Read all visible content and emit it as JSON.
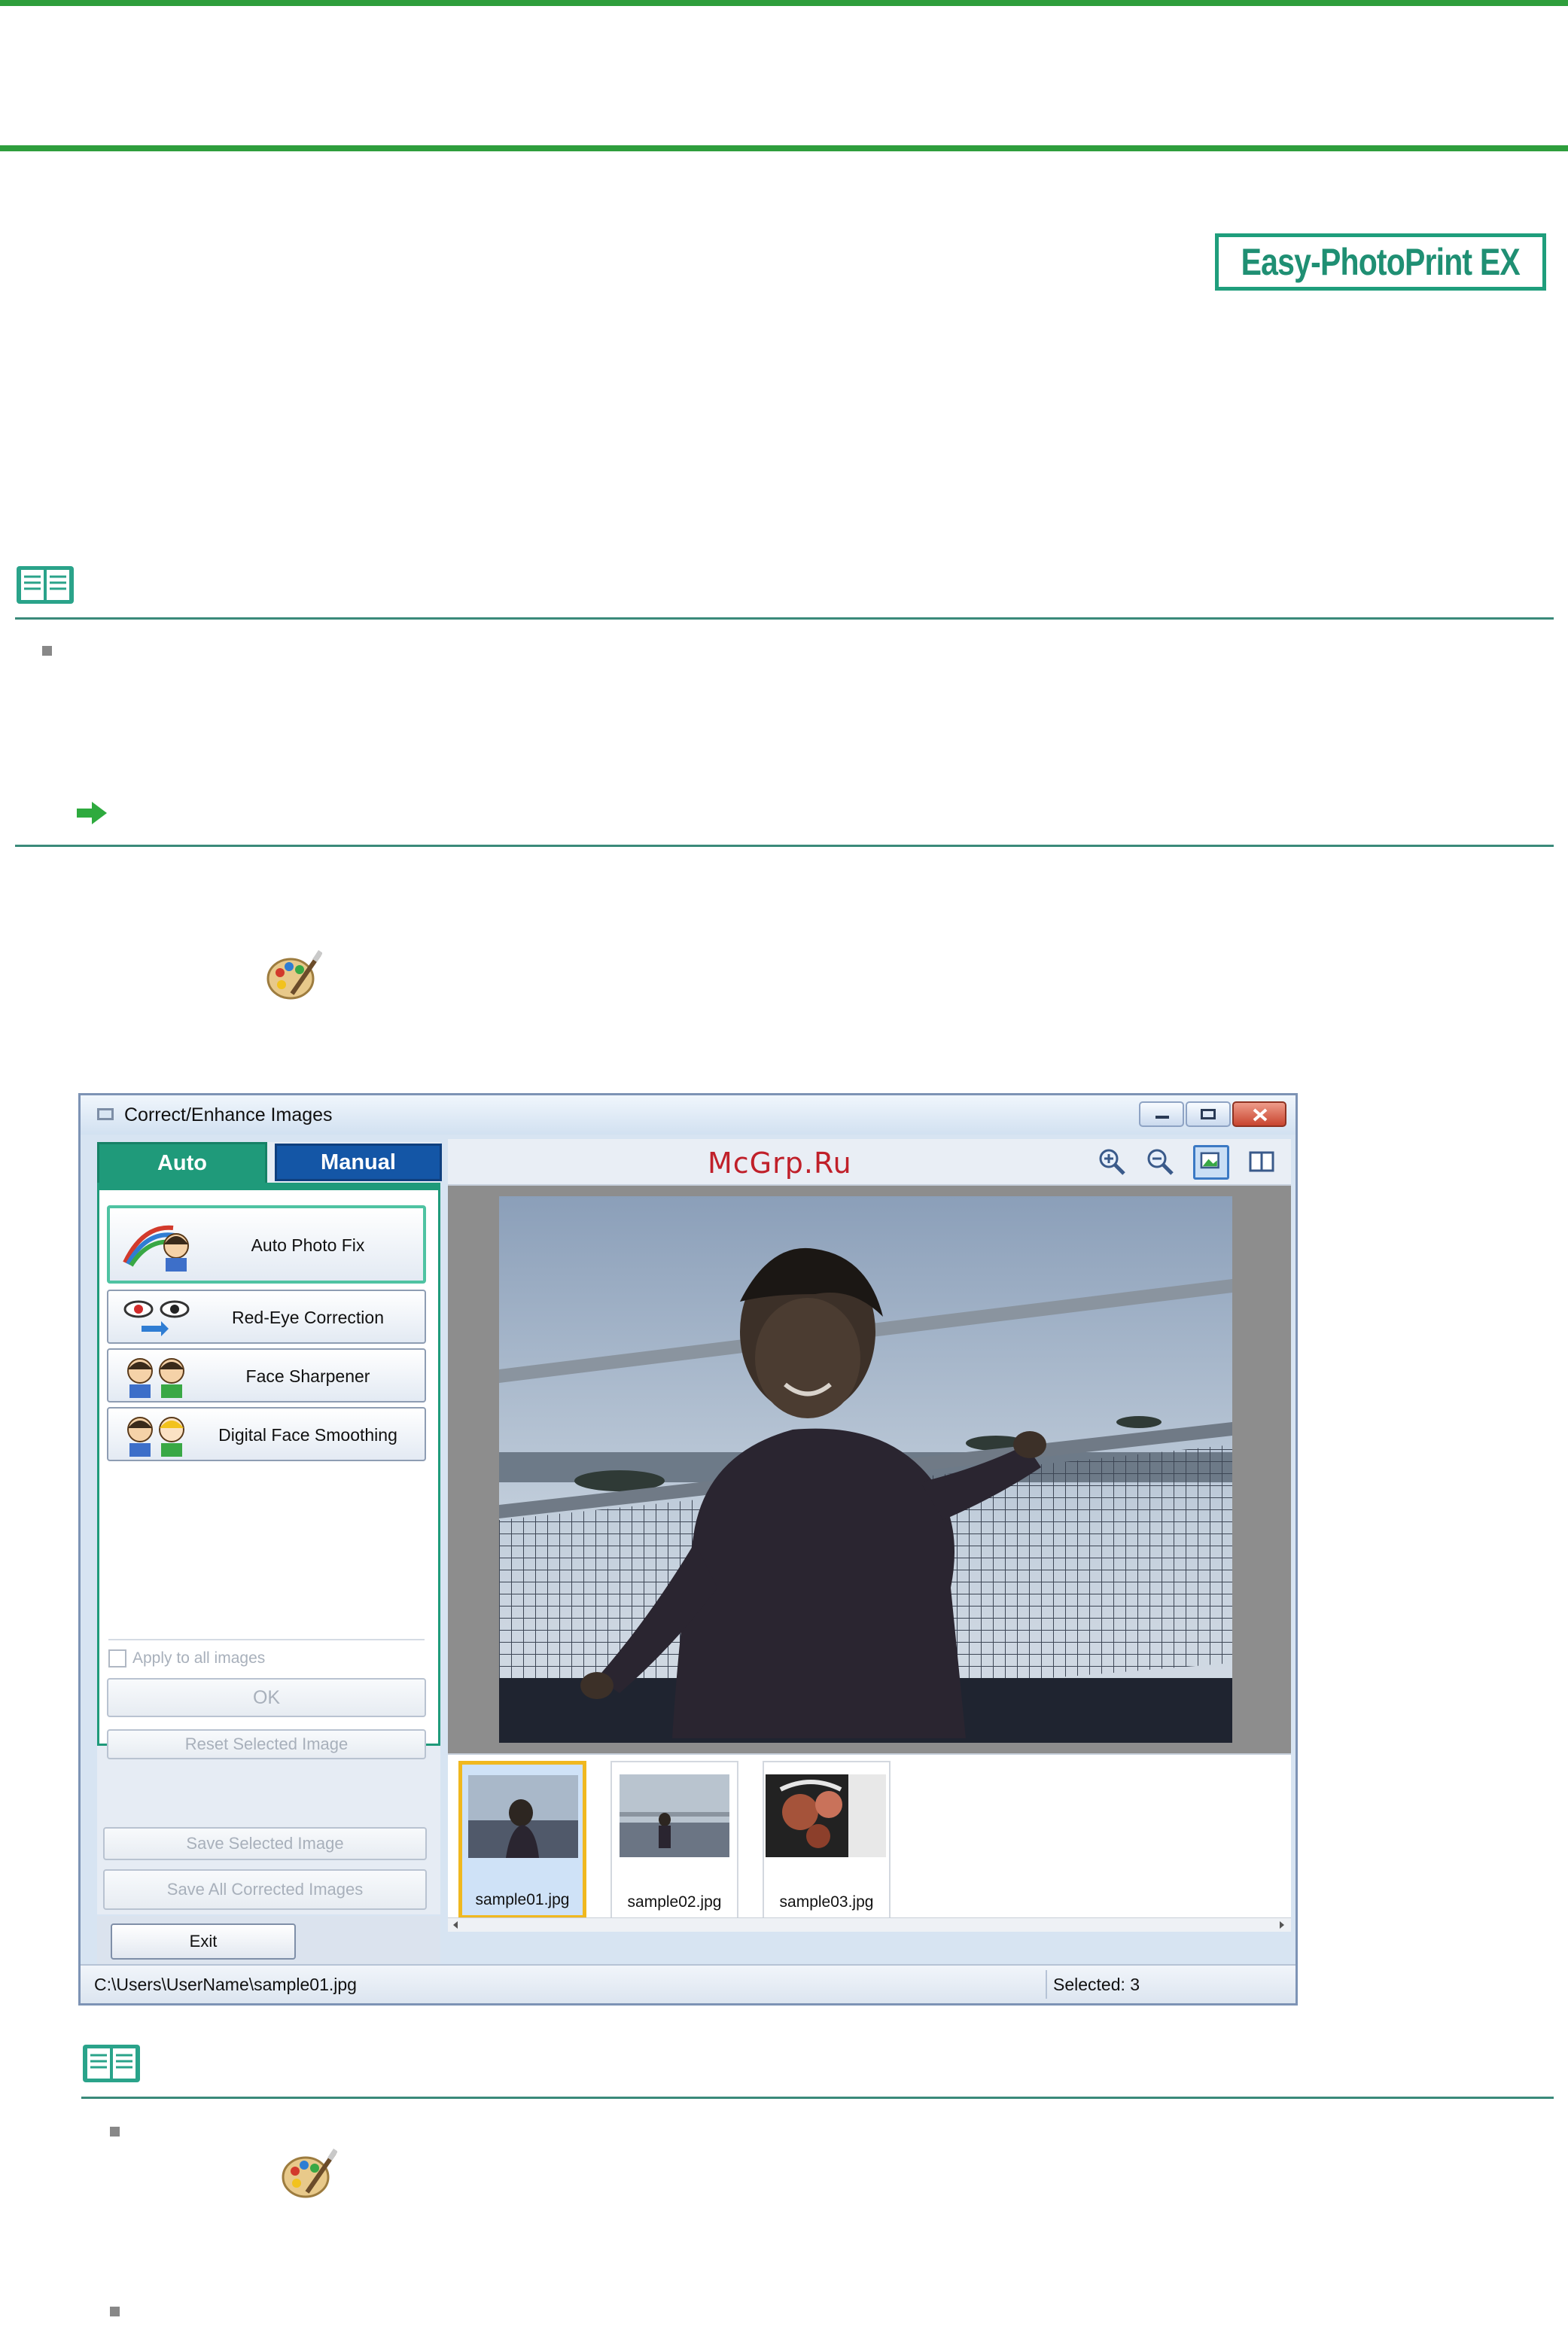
{
  "brand_badge": "Easy-PhotoPrint EX",
  "window": {
    "title": "Correct/Enhance Images",
    "tabs": [
      "Auto",
      "Manual"
    ],
    "fix_buttons": [
      "Auto Photo Fix",
      "Red-Eye Correction",
      "Face Sharpener",
      "Digital Face Smoothing"
    ],
    "apply_all_label": "Apply to all images",
    "ok_label": "OK",
    "reset_label": "Reset Selected Image",
    "save_selected_label": "Save Selected Image",
    "save_all_label": "Save All Corrected Images",
    "exit_label": "Exit",
    "watermark": "McGrp.Ru",
    "thumbnails": [
      "sample01.jpg",
      "sample02.jpg",
      "sample03.jpg"
    ],
    "status_path": "C:\\Users\\UserName\\sample01.jpg",
    "status_selected": "Selected: 3"
  },
  "colors": {
    "page_rule": "#2e9e3c",
    "note_rule": "#3a8a7a",
    "auto_tab": "#1f9a7a",
    "manual_tab": "#1456a6",
    "selected_thumb": "#f0b81f"
  }
}
